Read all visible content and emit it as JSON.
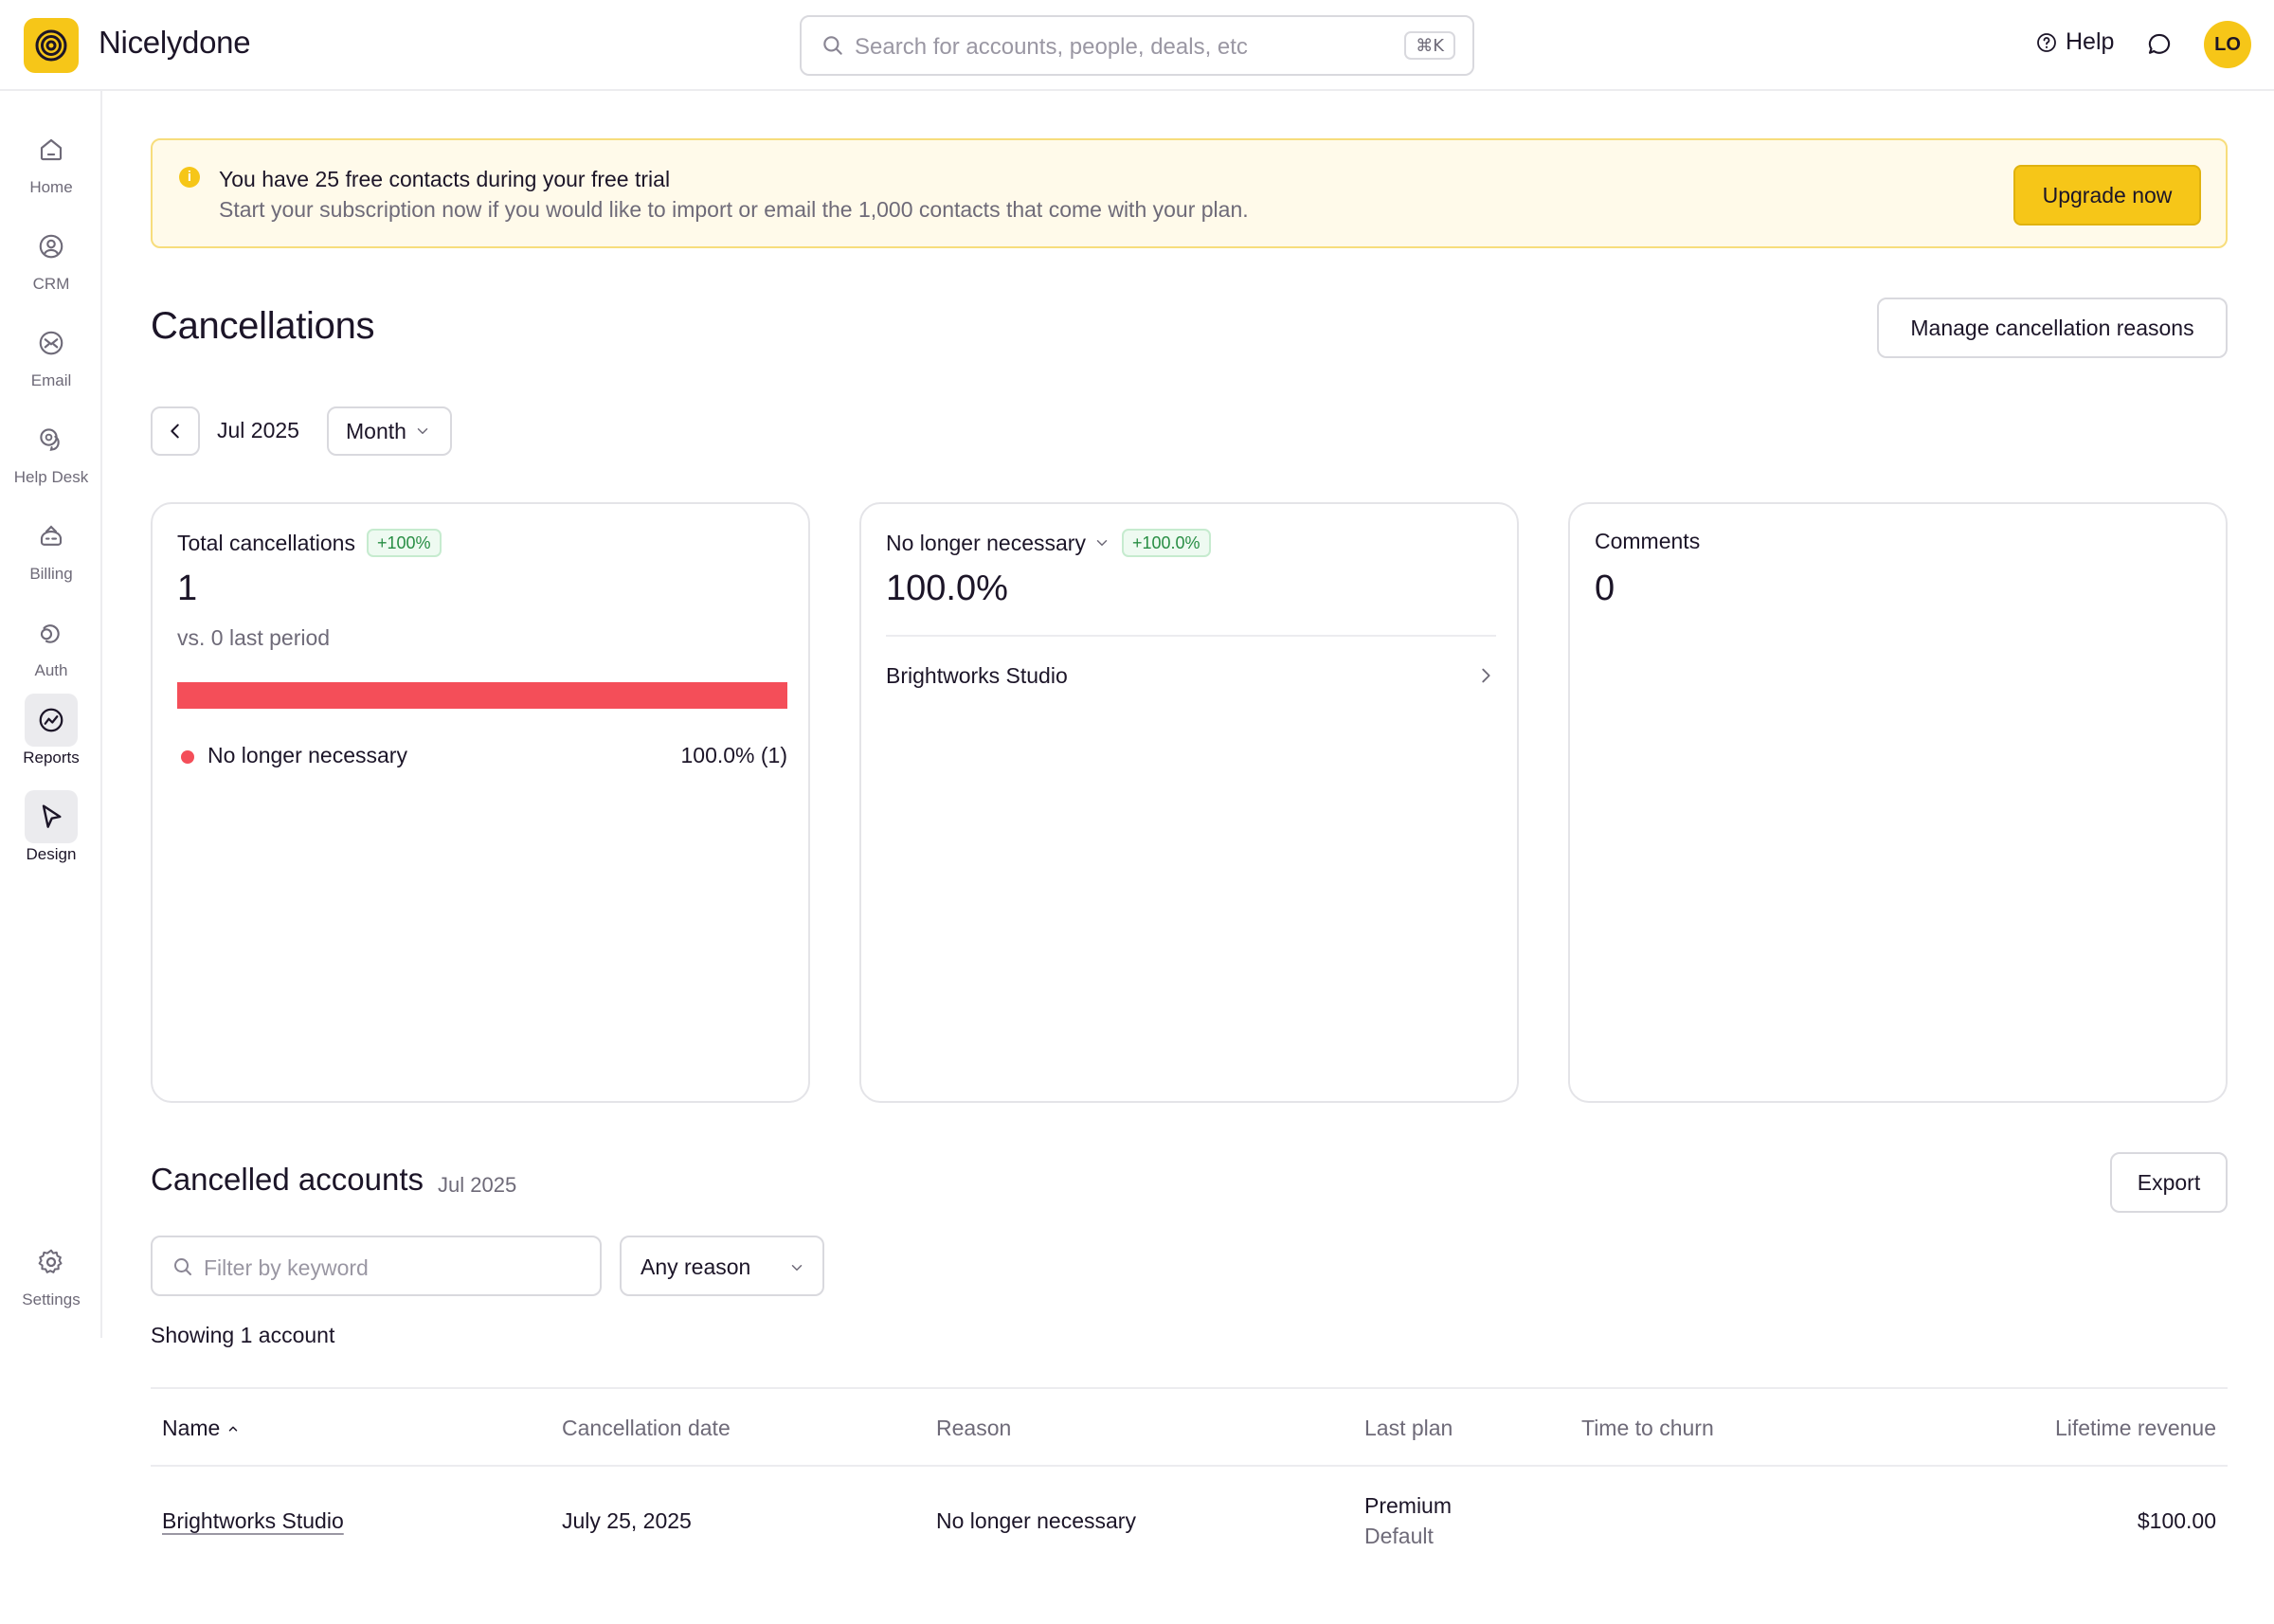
{
  "app": {
    "name": "Nicelydone"
  },
  "search": {
    "placeholder": "Search for accounts, people, deals, etc",
    "shortcut": "⌘K"
  },
  "header": {
    "help_label": "Help",
    "avatar_initials": "LO"
  },
  "sidebar": {
    "items": [
      {
        "label": "Home",
        "icon": "home-icon",
        "active": false
      },
      {
        "label": "CRM",
        "icon": "user-circle-icon",
        "active": false
      },
      {
        "label": "Email",
        "icon": "email-icon",
        "active": false
      },
      {
        "label": "Help Desk",
        "icon": "help-desk-icon",
        "active": false
      },
      {
        "label": "Billing",
        "icon": "billing-icon",
        "active": false
      },
      {
        "label": "Auth",
        "icon": "auth-icon",
        "active": false
      },
      {
        "label": "Reports",
        "icon": "reports-icon",
        "active": true
      },
      {
        "label": "Design",
        "icon": "cursor-icon",
        "active": true
      }
    ],
    "settings_label": "Settings"
  },
  "banner": {
    "title": "You have 25 free contacts during your free trial",
    "subtitle": "Start your subscription now if you would like to import or email the 1,000 contacts that come with your plan.",
    "button_label": "Upgrade now"
  },
  "page": {
    "title": "Cancellations",
    "manage_button": "Manage cancellation reasons",
    "period": "Jul 2025",
    "granularity": "Month"
  },
  "cards": {
    "total": {
      "title": "Total cancellations",
      "badge": "+100%",
      "value": "1",
      "comparison": "vs. 0 last period",
      "legend_name": "No longer necessary",
      "legend_value": "100.0% (1)",
      "bar_fraction": 1.0
    },
    "reason": {
      "title": "No longer necessary",
      "badge": "+100.0%",
      "value": "100.0%",
      "account": "Brightworks Studio"
    },
    "comments": {
      "title": "Comments",
      "value": "0"
    }
  },
  "cancelled": {
    "title": "Cancelled accounts",
    "period": "Jul 2025",
    "export_label": "Export",
    "filter_placeholder": "Filter by keyword",
    "reason_filter": "Any reason",
    "showing": "Showing 1 account"
  },
  "table": {
    "headers": {
      "name": "Name",
      "date": "Cancellation date",
      "reason": "Reason",
      "plan": "Last plan",
      "churn": "Time to churn",
      "revenue": "Lifetime revenue"
    },
    "rows": [
      {
        "name": "Brightworks Studio",
        "date": "July 25, 2025",
        "reason": "No longer necessary",
        "plan": "Premium",
        "plan_variant": "Default",
        "churn": "",
        "revenue": "$100.00"
      }
    ]
  },
  "colors": {
    "brand": "#f6c618",
    "cancel_bar": "#f44e59",
    "badge_green": "#278d43"
  }
}
